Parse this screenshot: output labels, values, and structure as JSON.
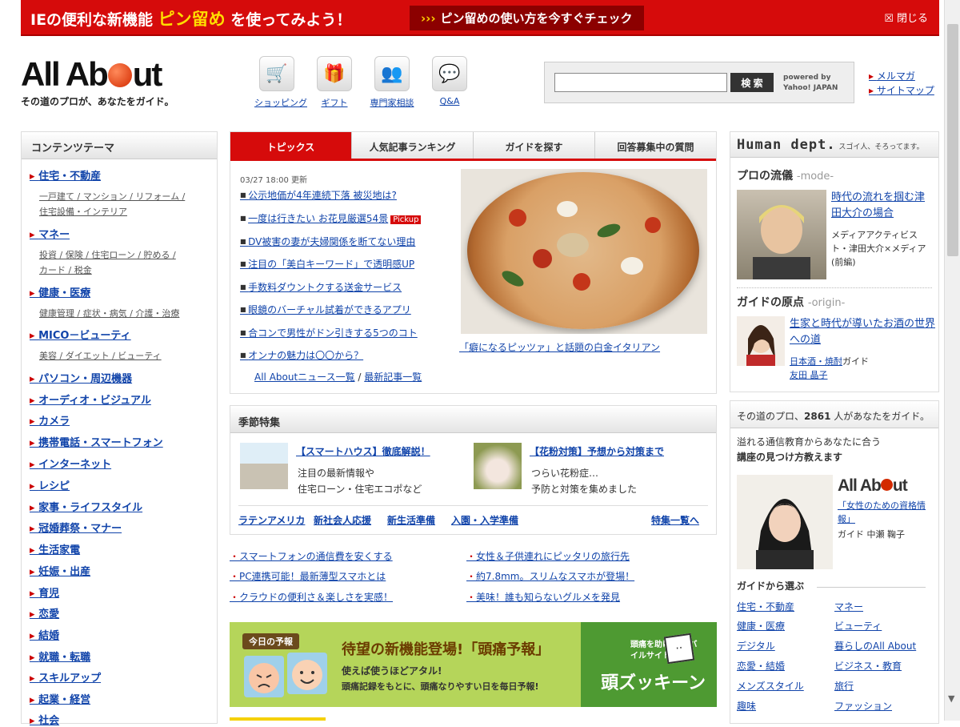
{
  "banner": {
    "pre": "IEの便利な新機能 ",
    "highlight": "ピン留め",
    "post": " を使ってみよう！",
    "cta_arrow": "›››",
    "cta": "ピン留めの使い方を今すぐチェック",
    "close": "閉じる",
    "close_icon": "☒"
  },
  "logo": {
    "part1": "All Ab",
    "part2": "ut",
    "tagline": "その道のプロが、あなたをガイド。"
  },
  "service_icons": [
    {
      "label": "ショッピング",
      "icon": "cart-icon",
      "glyph": "🛒"
    },
    {
      "label": "ギフト",
      "icon": "gift-icon",
      "glyph": "🎁"
    },
    {
      "label": "専門家相談",
      "icon": "people-icon",
      "glyph": "👥"
    },
    {
      "label": "Q&A",
      "icon": "qa-icon",
      "glyph": "💬"
    }
  ],
  "search": {
    "button": "検 索",
    "powered1": "powered by",
    "powered2": "Yahoo! JAPAN"
  },
  "top_links": [
    "メルマガ",
    "サイトマップ"
  ],
  "left_nav": {
    "header": "コンテンツテーマ",
    "cats": [
      "住宅・不動産",
      "マネー",
      "健康・医療",
      "MICO－ビューティ",
      "パソコン・周辺機器",
      "オーディオ・ビジュアル",
      "カメラ",
      "携帯電話・スマートフォン",
      "インターネット",
      "レシピ",
      "家事・ライフスタイル",
      "冠婚葬祭・マナー",
      "生活家電",
      "妊娠・出産",
      "育児",
      "恋愛",
      "結婚",
      "就職・転職",
      "スキルアップ",
      "起業・経営",
      "社会"
    ],
    "subs": {
      "s0a": "一戸建て / マンション / リフォーム /",
      "s0b": "住宅設備・インテリア",
      "s1a": "投資 / 保険 / 住宅ローン / 貯める /",
      "s1b": "カード / 税金",
      "s2": "健康管理 / 症状・病気 / 介護・治療",
      "s3": "美容 / ダイエット / ビューティ"
    }
  },
  "topics": {
    "tabs": [
      "トピックス",
      "人気記事ランキング",
      "ガイドを探す",
      "回答募集中の質問"
    ],
    "date": "03/27 18:00 更新",
    "items": [
      "公示地価が4年連続下落 被災地は?",
      "一度は行きたい お花見厳選54景",
      "DV被害の妻が夫婦関係を断てない理由",
      "注目の「美白キーワード」で透明感UP",
      "手数料ダウントクする送金サービス",
      "眼鏡のバーチャル試着ができるアプリ",
      "合コンで男性がドン引きする5つのコト",
      "オンナの魅力は〇〇から？"
    ],
    "pickup": "Pickup",
    "more1": "All Aboutニュース一覧",
    "sep": " / ",
    "more2": "最新記事一覧",
    "caption": "「癖になるピッツァ」と話題の白金イタリアン"
  },
  "season": {
    "header": "季節特集",
    "f1_title": "【スマートハウス】徹底解説！",
    "f1_d1": "注目の最新情報や",
    "f1_d2": "住宅ローン・住宅エコポなど",
    "f2_title": "【花粉対策】予想から対策まで",
    "f2_d1": "つらい花粉症…",
    "f2_d2": "予防と対策を集めました",
    "links": [
      "ラテンアメリカ",
      "新社会人応援",
      "新生活準備",
      "入園・入学準備"
    ],
    "all": "特集一覧へ"
  },
  "pr_links": [
    "スマートフォンの通信費を安くする",
    "PC連携可能！最新薄型スマホとは",
    "クラウドの便利さ＆楽しさを実感！",
    "女性＆子供連れにピッタリの旅行先",
    "約7.8mm。スリムなスマホが登場！",
    "美味！誰も知らないグルメを発見"
  ],
  "zutsu": {
    "label": "今日の予報",
    "headline": "待望の新機能登場!「頭痛予報」",
    "sub1": "使えば使うほどアタル!",
    "sub2": "頭痛記録をもとに、頭痛なりやすい日を毎日予報!",
    "g1": "頭痛を助ける モバイルサイト",
    "g2": "頭ズッキーン"
  },
  "human": {
    "title": "Human dept.",
    "tag": "スゴイ人、そろってます。",
    "sec1": "プロの流儀",
    "sec1_en": "-mode-",
    "p1_title": "時代の流れを掴む津田大介の場合",
    "p1_meta": "メディアアクティビスト・津田大介×メディア(前編)",
    "sec2": "ガイドの原点",
    "sec2_en": "-origin-",
    "p2_title": "生家と時代が導いたお酒の世界への道",
    "p2_cat": "日本酒・焼酎",
    "p2_role": "ガイド",
    "p2_name": "友田 晶子"
  },
  "guide": {
    "header_pre": "その道のプロ、",
    "count": "2861",
    "header_post": " 人があなたをガイド。",
    "intro1": "溢れる通信教育からあなたに合う",
    "intro2": "講座の見つけ方教えます",
    "logo_a": "All Ab",
    "logo_b": "ut",
    "article": "「女性のための資格情報」",
    "meta": "ガイド  中瀬 鞠子",
    "select": "ガイドから選ぶ",
    "left": [
      "住宅・不動産",
      "健康・医療",
      "デジタル",
      "恋愛・結婚",
      "メンズスタイル",
      "趣味"
    ],
    "right": [
      "マネー",
      "ビューティ",
      "暮らしのAll About",
      "ビジネス・教育",
      "旅行",
      "ファッション"
    ]
  }
}
